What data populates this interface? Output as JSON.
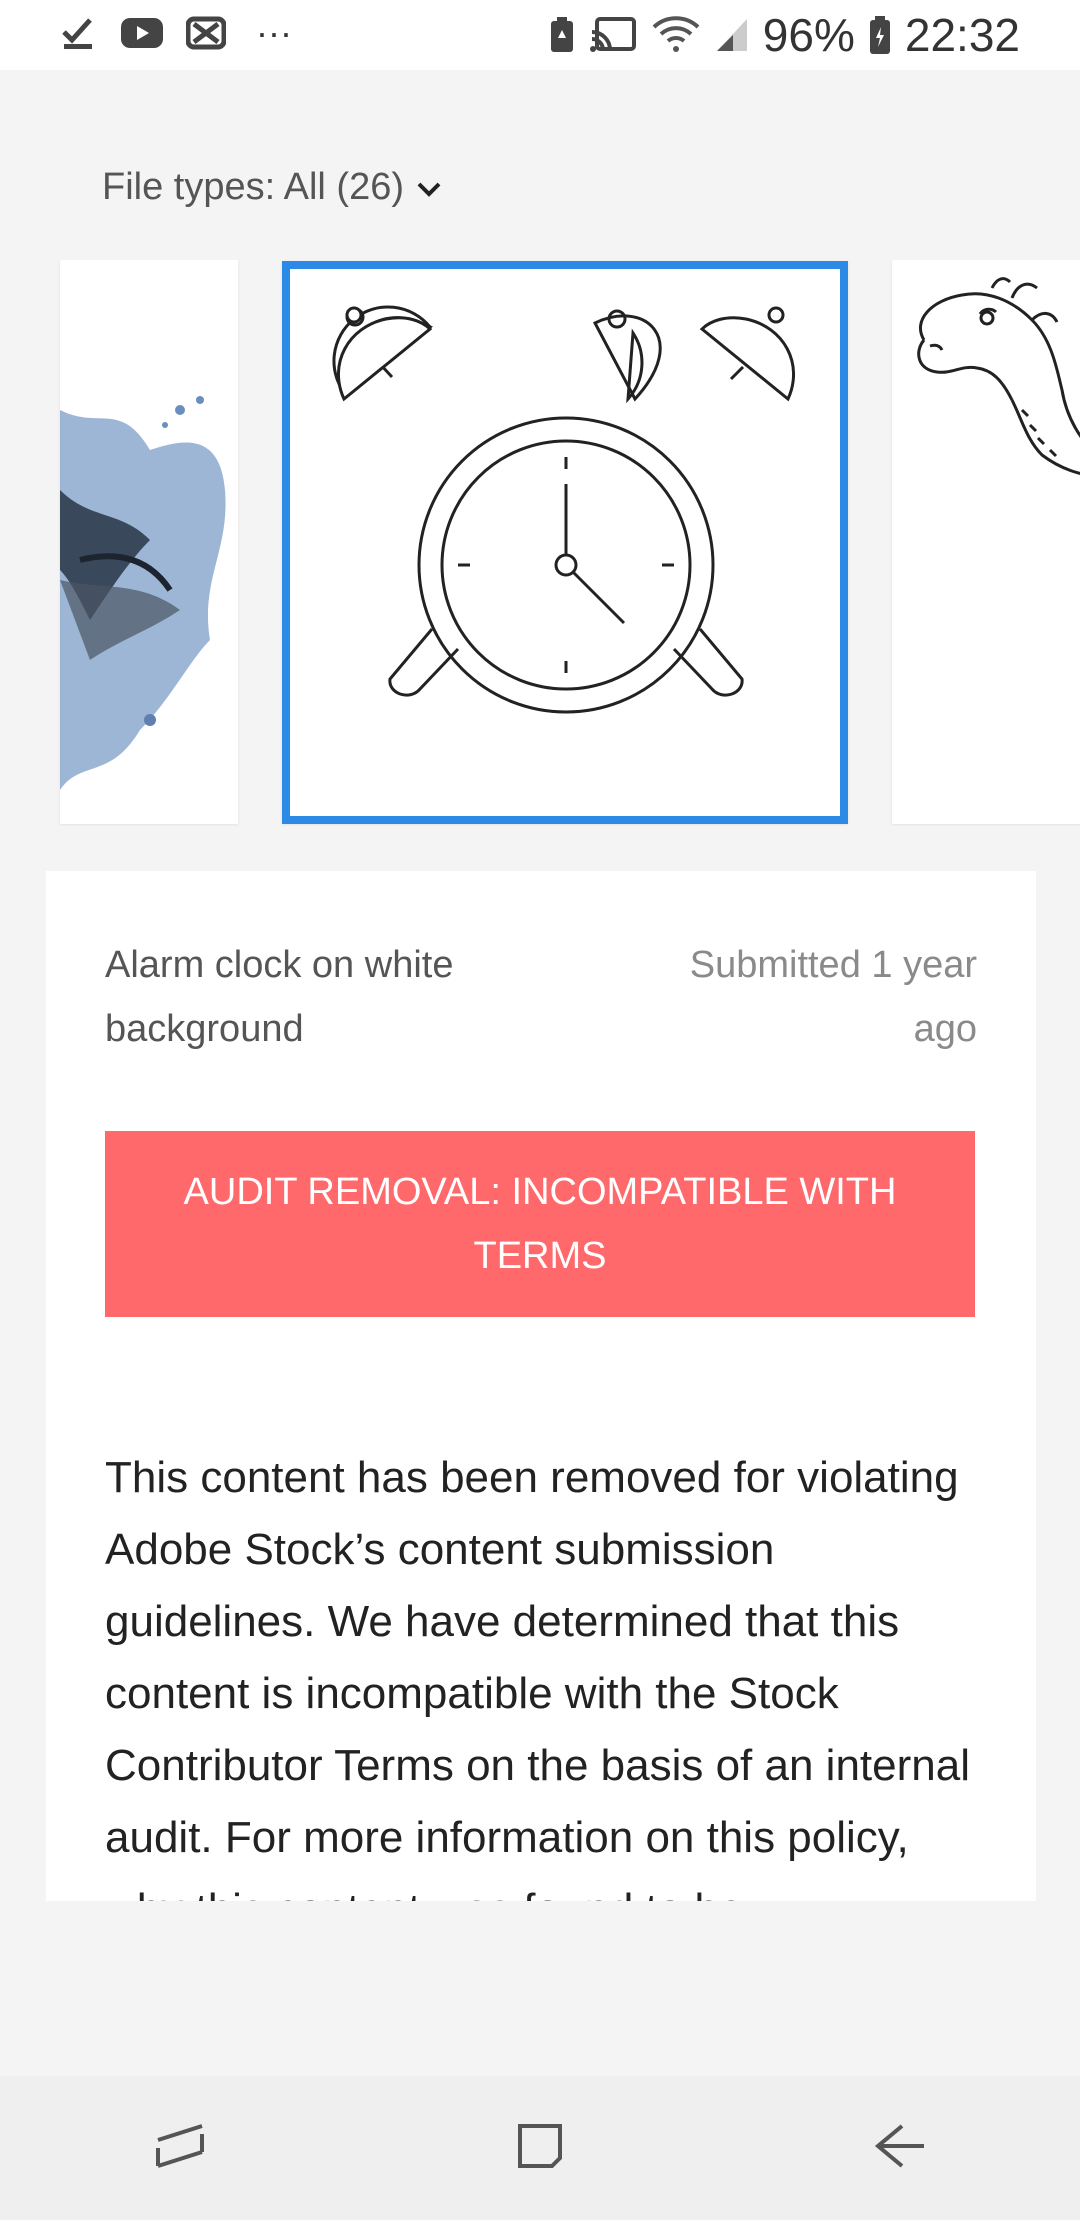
{
  "status_bar": {
    "battery_percent": "96%",
    "time": "22:32",
    "overflow": "···",
    "icons": [
      "download-complete-icon",
      "youtube-icon",
      "app-notification-icon",
      "more-notifications-icon",
      "battery-saver-icon",
      "cast-icon",
      "wifi-icon",
      "signal-icon",
      "battery-icon"
    ]
  },
  "filter": {
    "label": "File types: All (26)",
    "icon": "chevron-down-icon"
  },
  "carousel": {
    "items": [
      {
        "name": "watercolor-animal-thumbnail",
        "selected": false
      },
      {
        "name": "alarm-clock-thumbnail",
        "selected": true
      },
      {
        "name": "camel-thumbnail",
        "selected": false
      }
    ],
    "selected_border_color": "#2b8ae6"
  },
  "detail": {
    "title": "Alarm clock on white background",
    "submitted": "Submitted 1 year ago",
    "status_label": "AUDIT REMOVAL: INCOMPATIBLE WITH TERMS",
    "status_color": "#ff696b",
    "body": "This content has been removed for violating Adobe Stock’s content submission guidelines. We have determined that this content is incompatible with the Stock Contributor Terms on the basis of an internal audit. For more information on this policy, why this content was found to be"
  },
  "nav_bar": {
    "buttons": [
      "recent-apps-icon",
      "home-icon",
      "back-icon"
    ]
  }
}
